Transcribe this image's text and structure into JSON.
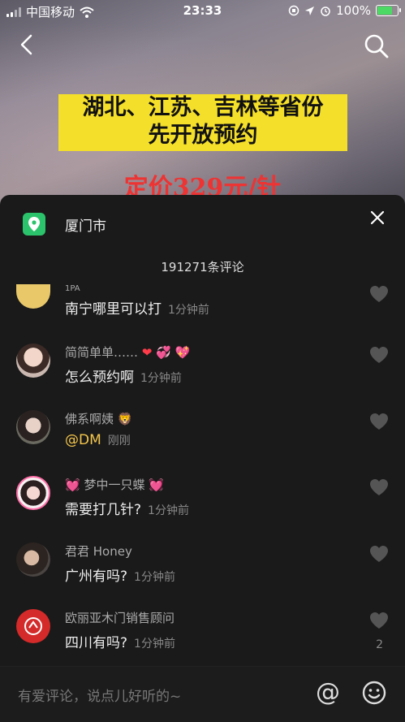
{
  "status": {
    "carrier": "中国移动",
    "time": "23:33",
    "battery": "100%"
  },
  "video": {
    "banner_line1": "湖北、江苏、吉林等省份",
    "banner_line2": "先开放预约",
    "price": "定价329元/针"
  },
  "sheet": {
    "location": "厦门市",
    "comment_count": "191271条评论",
    "input_placeholder": "有爱评论，说点儿好听的~",
    "at_symbol": "@"
  },
  "comments": [
    {
      "name": "1PA",
      "text": "南宁哪里可以打",
      "ago": "1分钟前",
      "likes": ""
    },
    {
      "name": "简简单单……",
      "text": "怎么预约啊",
      "ago": "1分钟前",
      "likes": ""
    },
    {
      "name": "佛系啊姨",
      "text": "@DM",
      "ago": "刚刚",
      "likes": ""
    },
    {
      "name": "梦中一只蝶",
      "text": "需要打几针?",
      "ago": "1分钟前",
      "likes": ""
    },
    {
      "name": "君君 Honey",
      "text": "广州有吗?",
      "ago": "1分钟前",
      "likes": ""
    },
    {
      "name": "欧丽亚木门销售顾问",
      "text": "四川有吗?",
      "ago": "1分钟前",
      "likes": "2"
    }
  ],
  "icons": {
    "back": "chevron-left-icon",
    "search": "search-icon",
    "location": "location-pin-icon",
    "close": "close-icon",
    "like": "heart-icon",
    "emoji": "smiley-icon"
  },
  "colors": {
    "banner": "#f4df2a",
    "price": "#ee3333",
    "pin": "#2bc36b",
    "mention": "#f4c64b"
  }
}
